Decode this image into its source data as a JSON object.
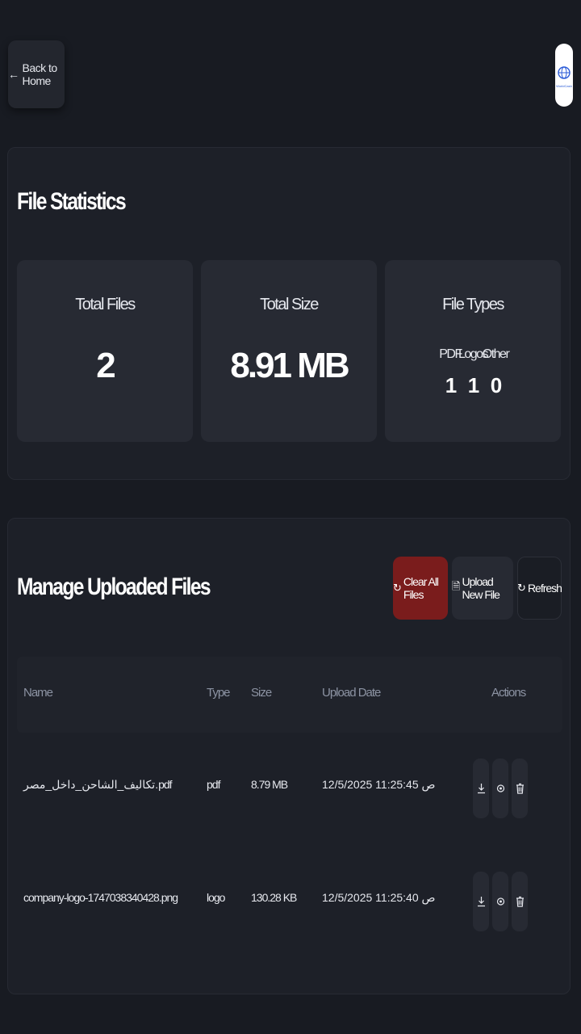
{
  "header": {
    "back_label": "Back to Home",
    "avatar_text": "WorldCash"
  },
  "stats": {
    "title": "File Statistics",
    "total_files_label": "Total Files",
    "total_files_value": "2",
    "total_size_label": "Total Size",
    "total_size_value": "8.91 MB",
    "file_types_label": "File Types",
    "types": [
      {
        "name": "PDF",
        "count": "1"
      },
      {
        "name": "Logos",
        "count": "1"
      },
      {
        "name": "Other",
        "count": "0"
      }
    ]
  },
  "manage": {
    "title": "Manage Uploaded Files",
    "clear_label": "Clear All Files",
    "upload_label": "Upload New File",
    "refresh_label": "Refresh",
    "columns": {
      "name": "Name",
      "type": "Type",
      "size": "Size",
      "date": "Upload Date",
      "actions": "Actions"
    },
    "rows": [
      {
        "name": "تكاليف_الشاحن_داخل_مصر.pdf",
        "type": "pdf",
        "size": "8.79 MB",
        "date": "12/5/2025 11:25:45 ص"
      },
      {
        "name": "company-logo-1747038340428.png",
        "type": "logo",
        "size": "130.28 KB",
        "date": "12/5/2025 11:25:40 ص"
      }
    ]
  },
  "colors": {
    "background": "#181b22",
    "card": "#1d2028",
    "danger": "#7a1c1c"
  },
  "icons": [
    "arrow-left-icon",
    "globe-icon",
    "refresh-icon",
    "file-icon",
    "download-icon",
    "view-icon",
    "trash-icon"
  ]
}
